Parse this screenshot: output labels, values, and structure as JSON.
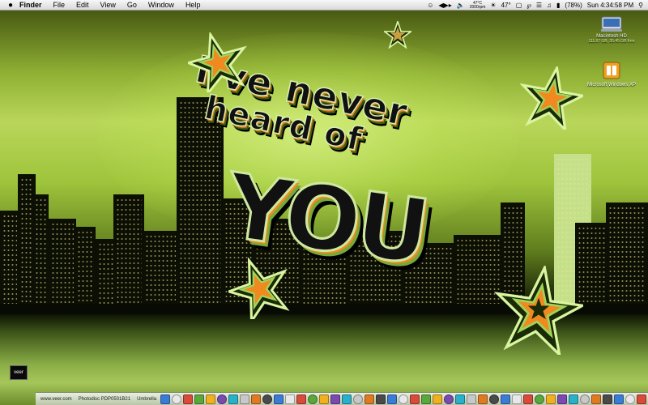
{
  "menubar": {
    "apple_icon": "apple-icon",
    "app_name": "Finder",
    "menus": [
      "File",
      "Edit",
      "View",
      "Go",
      "Window",
      "Help"
    ],
    "extras": {
      "cpu_temp": "47°C",
      "fan_speed": "2000rpm",
      "temp_display": "47°",
      "battery_percent": "(78%)",
      "clock": "Sun 4:34:58 PM"
    }
  },
  "wallpaper": {
    "line1": "I've never",
    "line2": "heard of",
    "line3": "YOU",
    "watermark": "veer"
  },
  "desktop_icons": [
    {
      "name": "Macintosh HD",
      "subtitle": "111.67 GB, 35.45 GB free",
      "icon": "hard-drive-icon"
    },
    {
      "name": "Microsoft Windows XP",
      "subtitle": "",
      "icon": "windows-xp-icon"
    }
  ],
  "dock": {
    "labels": [
      "www.veer.com",
      "Photodisc PDP0501B21",
      "Umbrella"
    ],
    "icon_count": 46
  },
  "colors": {
    "accent_green": "#9fc43c",
    "accent_orange": "#e37a1a",
    "menubar": "#e8e8e8"
  }
}
